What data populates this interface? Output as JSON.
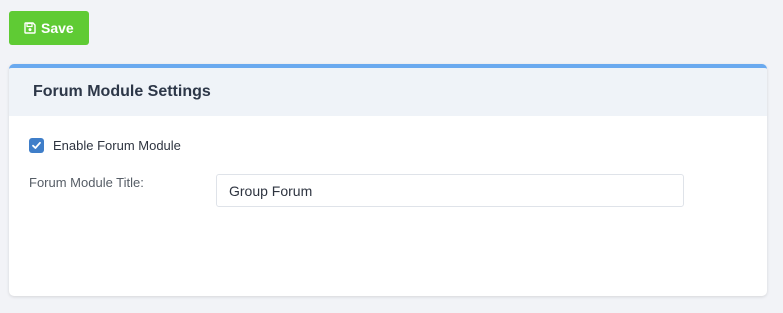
{
  "toolbar": {
    "save_label": "Save",
    "save_icon": "floppy-disk-icon"
  },
  "panel": {
    "title": "Forum Module Settings",
    "enable_checkbox": {
      "label": "Enable Forum Module",
      "checked": true
    },
    "title_field": {
      "label": "Forum Module Title:",
      "value": "Group Forum"
    }
  },
  "colors": {
    "save_button": "#5fcb34",
    "panel_accent": "#6aa9ef",
    "checkbox": "#3f7ec9",
    "page_background": "#f2f3f7"
  }
}
